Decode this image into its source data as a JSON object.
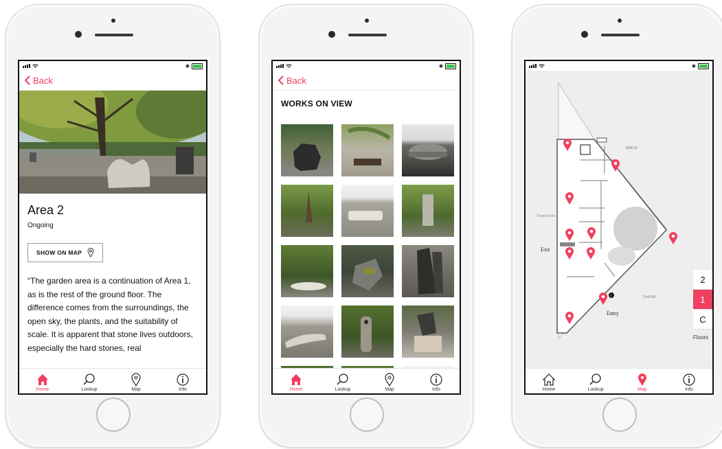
{
  "theme": {
    "accent": "#f0405f"
  },
  "screens": [
    {
      "back_label": "Back",
      "title": "Area 2",
      "subtitle": "Ongoing",
      "show_on_map_label": "SHOW ON MAP",
      "description": "“The garden area is a continuation of Area 1, as is the rest of the ground floor. The difference comes from the surroundings, the open sky, the plants, and the suitability of scale. It is apparent that stone lives outdoors, especially the hard stones, real"
    },
    {
      "back_label": "Back",
      "heading": "WORKS ON VIEW",
      "works_count": 15
    },
    {
      "map_labels": {
        "street_top": "80th St",
        "street_bottom": "33rd Rd",
        "vernon": "Vernon Blvd",
        "exit": "Exit",
        "entry": "Entry"
      },
      "floors": [
        "2",
        "1",
        "C"
      ],
      "selected_floor": "1",
      "floors_label": "Floors"
    }
  ],
  "tabs": [
    {
      "label": "Home",
      "icon": "home-icon"
    },
    {
      "label": "Lookup",
      "icon": "search-icon"
    },
    {
      "label": "Map",
      "icon": "map-pin-icon"
    },
    {
      "label": "Info",
      "icon": "info-icon"
    }
  ]
}
